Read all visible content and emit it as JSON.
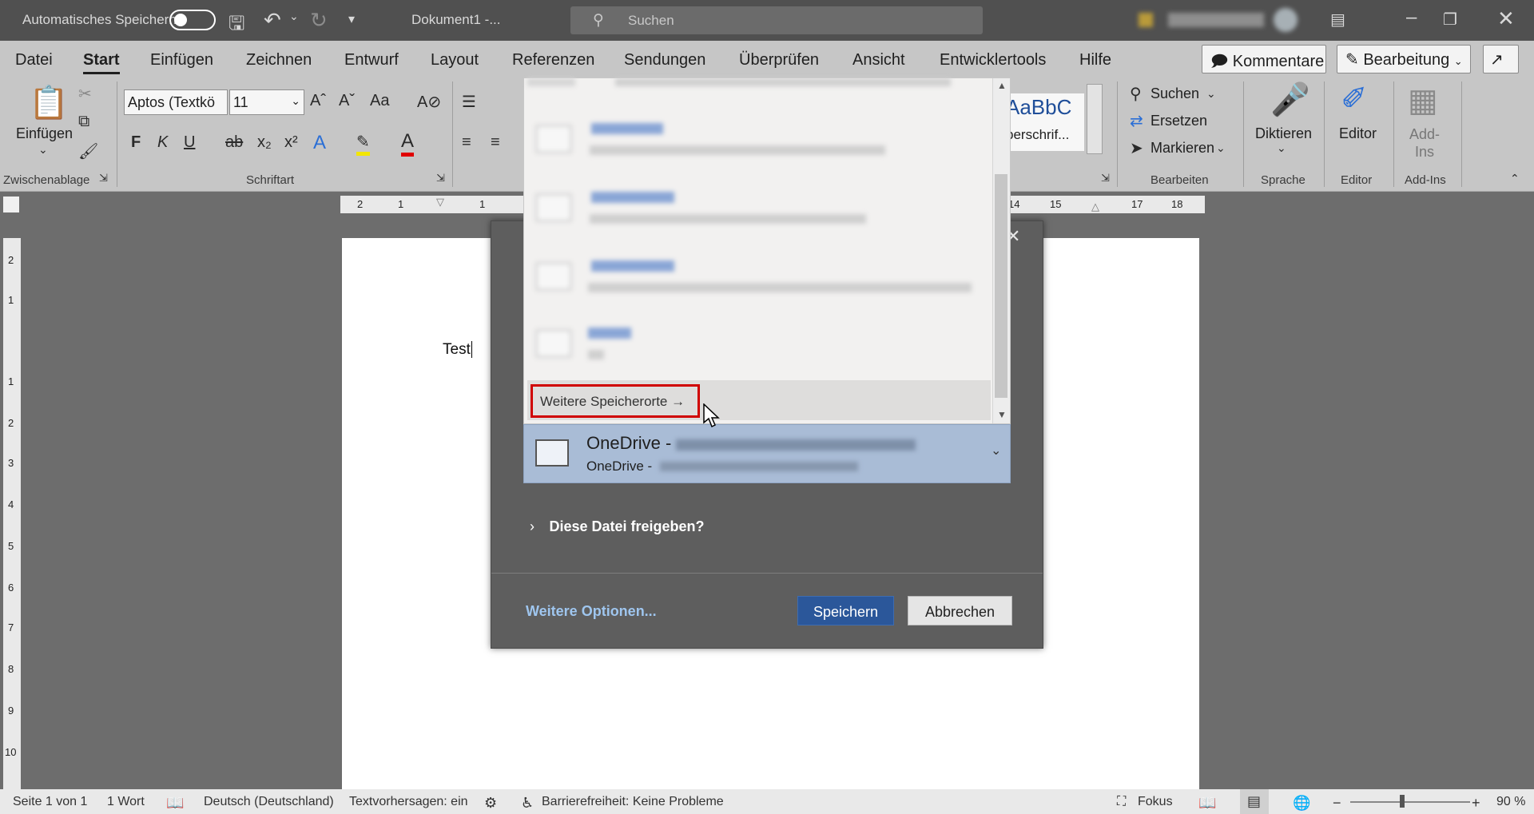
{
  "title_bar": {
    "autosave_label": "Automatisches Speichern",
    "document_title": "Dokument1 -...",
    "search_placeholder": "Suchen"
  },
  "tabs": [
    "Datei",
    "Start",
    "Einfügen",
    "Zeichnen",
    "Entwurf",
    "Layout",
    "Referenzen",
    "Sendungen",
    "Überprüfen",
    "Ansicht",
    "Entwicklertools",
    "Hilfe"
  ],
  "header_buttons": {
    "comments": "Kommentare",
    "editing": "Bearbeitung"
  },
  "ribbon": {
    "paste": "Einfügen",
    "clipboard_group": "Zwischenablage",
    "font_name": "Aptos (Textkö",
    "font_size": "11",
    "change_case": "Aa",
    "font_group": "Schriftart",
    "bold": "F",
    "italic": "K",
    "underline": "U",
    "styles_preview": "AaBbC",
    "styles_label": "berschrif...",
    "find": "Suchen",
    "replace": "Ersetzen",
    "select": "Markieren",
    "editing_group": "Bearbeiten",
    "dictate": "Diktieren",
    "language_group": "Sprache",
    "editor": "Editor",
    "editor_group": "Editor",
    "addins": "Add-\nIns",
    "addins_group": "Add-Ins"
  },
  "ruler": {
    "horizontal": [
      "2",
      "1",
      "1",
      "14",
      "15",
      "17",
      "18"
    ],
    "vertical": [
      "2",
      "1",
      "1",
      "2",
      "3",
      "4",
      "5",
      "6",
      "7",
      "8",
      "9",
      "10"
    ]
  },
  "document": {
    "text": "Test"
  },
  "dialog": {
    "more_locations": "Weitere Speicherorte →",
    "selected_location_title": "OneDrive -",
    "selected_location_subtitle": "OneDrive -",
    "share_label": "Diese Datei freigeben?",
    "more_options": "Weitere Optionen...",
    "save": "Speichern",
    "cancel": "Abbrechen"
  },
  "status_bar": {
    "page": "Seite 1 von 1",
    "words": "1 Wort",
    "language": "Deutsch (Deutschland)",
    "text_predictions": "Textvorhersagen: ein",
    "accessibility": "Barrierefreiheit: Keine Probleme",
    "focus": "Fokus",
    "zoom": "90 %"
  }
}
